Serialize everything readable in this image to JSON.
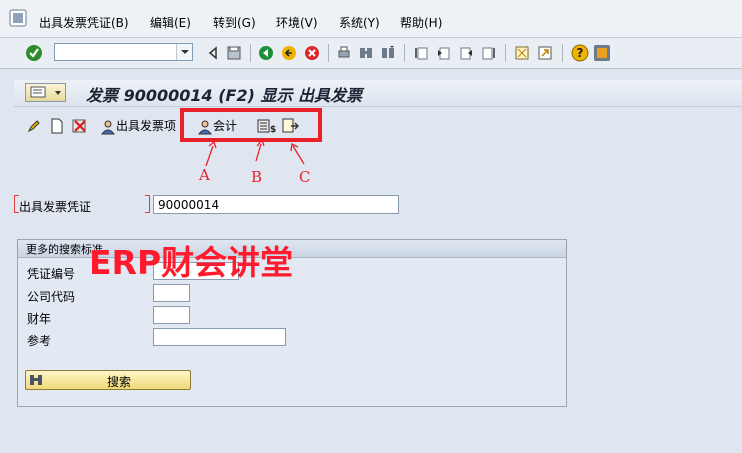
{
  "menubar": {
    "items": [
      "出具发票凭证(B)",
      "编辑(E)",
      "转到(G)",
      "环境(V)",
      "系统(Y)",
      "帮助(H)"
    ]
  },
  "std_toolbar": {
    "command_field_value": "",
    "icons": [
      "enter-check-icon",
      "save-icon",
      "back-icon",
      "exit-icon",
      "cancel-icon",
      "print-icon",
      "find-icon",
      "find-next-icon",
      "first-page-icon",
      "prev-page-icon",
      "next-page-icon",
      "last-page-icon",
      "create-session-icon",
      "shortcut-icon",
      "help-icon",
      "customize-layout-icon"
    ]
  },
  "title": {
    "text": "发票 90000014  (F2) 显示 出具发票"
  },
  "app_toolbar": {
    "items_label": "出具发票项",
    "accounting_label": "会计"
  },
  "annotations": {
    "a": "A",
    "b": "B",
    "c": "C"
  },
  "form": {
    "billing_doc_label": "出具发票凭证",
    "billing_doc_value": "90000014",
    "group_title": "更多的搜索标准",
    "fields": [
      {
        "label": "凭证编号",
        "value": ""
      },
      {
        "label": "公司代码",
        "value": ""
      },
      {
        "label": "财年",
        "value": ""
      },
      {
        "label": "参考",
        "value": ""
      }
    ],
    "search_button": "搜索"
  },
  "watermark": "ERP财会讲堂",
  "colors": {
    "annotation_red": "#e8202a",
    "background": "#dfe6ef",
    "search_button": "#f0d978"
  }
}
